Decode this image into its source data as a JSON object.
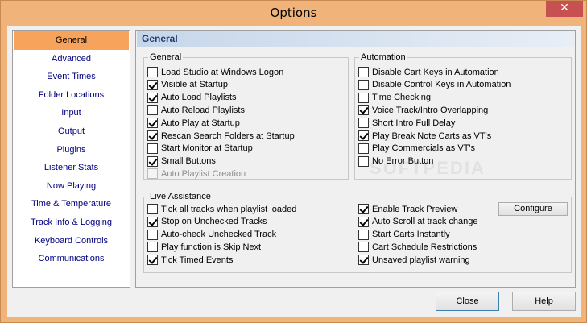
{
  "window": {
    "title": "Options",
    "close_glyph": "✕"
  },
  "sidebar": {
    "items": [
      {
        "label": "General",
        "active": true
      },
      {
        "label": "Advanced"
      },
      {
        "label": "Event Times"
      },
      {
        "label": "Folder Locations"
      },
      {
        "label": "Input"
      },
      {
        "label": "Output"
      },
      {
        "label": "Plugins"
      },
      {
        "label": "Listener Stats"
      },
      {
        "label": "Now Playing"
      },
      {
        "label": "Time & Temperature"
      },
      {
        "label": "Track Info & Logging"
      },
      {
        "label": "Keyboard Controls"
      },
      {
        "label": "Communications"
      }
    ]
  },
  "main": {
    "header": "General",
    "general_group": {
      "legend": "General",
      "options": [
        {
          "label": "Load Studio at Windows Logon",
          "checked": false
        },
        {
          "label": "Visible at Startup",
          "checked": true
        },
        {
          "label": "Auto Load Playlists",
          "checked": true
        },
        {
          "label": "Auto Reload Playlists",
          "checked": false
        },
        {
          "label": "Auto Play at Startup",
          "checked": true
        },
        {
          "label": "Rescan Search Folders at Startup",
          "checked": true
        },
        {
          "label": "Start Monitor at Startup",
          "checked": false
        },
        {
          "label": "Small Buttons",
          "checked": true
        },
        {
          "label": "Auto Playlist Creation",
          "checked": false,
          "disabled": true
        }
      ]
    },
    "automation_group": {
      "legend": "Automation",
      "options": [
        {
          "label": "Disable Cart Keys in Automation",
          "checked": false
        },
        {
          "label": "Disable Control Keys in Automation",
          "checked": false
        },
        {
          "label": "Time Checking",
          "checked": false
        },
        {
          "label": "Voice Track/Intro Overlapping",
          "checked": true
        },
        {
          "label": "Short Intro Full Delay",
          "checked": false
        },
        {
          "label": "Play Break Note Carts as VT's",
          "checked": true
        },
        {
          "label": "Play Commercials as VT's",
          "checked": false
        },
        {
          "label": "No Error Button",
          "checked": false
        }
      ]
    },
    "live_group": {
      "legend": "Live Assistance",
      "left_options": [
        {
          "label": "Tick all tracks when playlist loaded",
          "checked": false
        },
        {
          "label": "Stop on Unchecked Tracks",
          "checked": true
        },
        {
          "label": "Auto-check Unchecked Track",
          "checked": false
        },
        {
          "label": "Play function is Skip Next",
          "checked": false
        },
        {
          "label": "Tick Timed Events",
          "checked": true
        }
      ],
      "right_options": [
        {
          "label": "Enable Track Preview",
          "checked": true
        },
        {
          "label": "Auto Scroll at track change",
          "checked": true
        },
        {
          "label": "Start Carts Instantly",
          "checked": false
        },
        {
          "label": "Cart Schedule Restrictions",
          "checked": false
        },
        {
          "label": "Unsaved playlist warning",
          "checked": true
        }
      ],
      "configure_label": "Configure"
    }
  },
  "footer": {
    "close_label": "Close",
    "help_label": "Help"
  },
  "watermark": "SOFTPEDIA"
}
